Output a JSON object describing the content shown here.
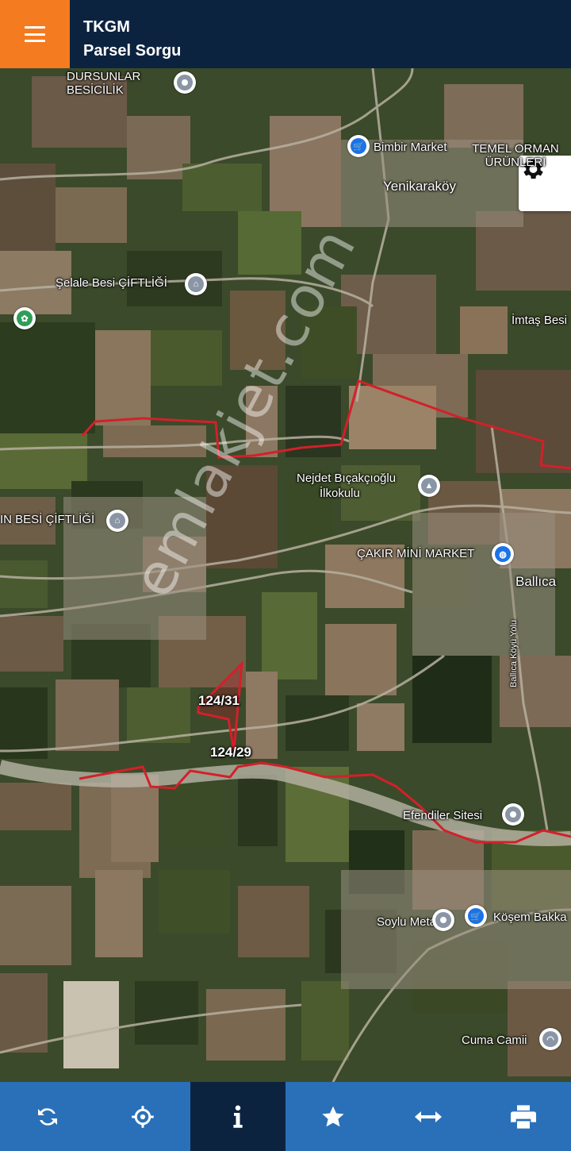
{
  "header": {
    "title": "TKGM",
    "subtitle": "Parsel Sorgu"
  },
  "map": {
    "poi": {
      "dursunlar": "DURSUNLAR BESİCİLİK",
      "bimbir": "Bimbir Market",
      "temel": "TEMEL ORMAN ÜRÜNLERİ",
      "yenikarakoy": "Yenikaraköy",
      "selale": "Şelale Besi ÇİFTLİĞİ",
      "imtas": "İmtaş Besi",
      "nejdet1": "Nejdet Bıçakçıoğlu",
      "nejdet2": "İlkokulu",
      "besi_ciftligi": "IN BESİ ÇİFTLİĞİ",
      "cakir": "ÇAKIR MİNİ MARKET",
      "ballica": "Ballıca",
      "ballica_yolu": "Ballıca Köyü Yolu",
      "efendiler": "Efendiler Sitesi",
      "soylu": "Soylu Metal",
      "kosem": "Köşem Bakka",
      "cuma": "Cuma Camii"
    },
    "parcels": {
      "p1": "124/31",
      "p2": "124/29"
    },
    "watermark": "emlakjet.com",
    "colors": {
      "boundary": "#d3202a",
      "parcel_fill": "#b81c2a"
    }
  },
  "toolbar": {
    "items": [
      {
        "icon": "refresh-icon",
        "active": false
      },
      {
        "icon": "locate-icon",
        "active": false
      },
      {
        "icon": "info-icon",
        "active": true
      },
      {
        "icon": "star-icon",
        "active": false
      },
      {
        "icon": "measure-icon",
        "active": false
      },
      {
        "icon": "print-icon",
        "active": false
      }
    ]
  },
  "colors": {
    "header_bg": "#0c2340",
    "menu_bg": "#f47b20",
    "toolbar_bg": "#2a70b8",
    "toolbar_active": "#0c2340"
  }
}
